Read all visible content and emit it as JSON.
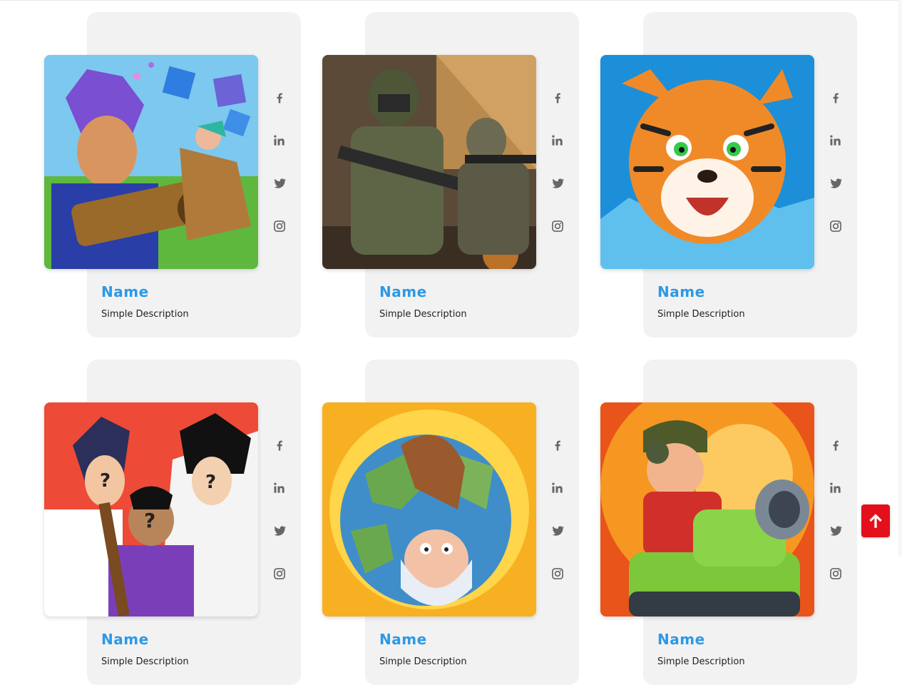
{
  "team": [
    {
      "name": "Name",
      "description": "Simple Description",
      "image": "game-art-hero-bazooka"
    },
    {
      "name": "Name",
      "description": "Simple Description",
      "image": "game-art-soldiers"
    },
    {
      "name": "Name",
      "description": "Simple Description",
      "image": "game-art-tiger"
    },
    {
      "name": "Name",
      "description": "Simple Description",
      "image": "game-art-mystery-characters"
    },
    {
      "name": "Name",
      "description": "Simple Description",
      "image": "game-art-earth-wizard"
    },
    {
      "name": "Name",
      "description": "Simple Description",
      "image": "game-art-tank-soldier"
    }
  ],
  "social_icons": [
    "facebook-icon",
    "linkedin-icon",
    "twitter-icon",
    "instagram-icon"
  ],
  "colors": {
    "accent": "#2c99e6",
    "card_bg": "#f2f2f2",
    "icon": "#666666",
    "to_top": "#e3101c"
  },
  "scroll_top": {
    "icon": "arrow-up-icon"
  }
}
